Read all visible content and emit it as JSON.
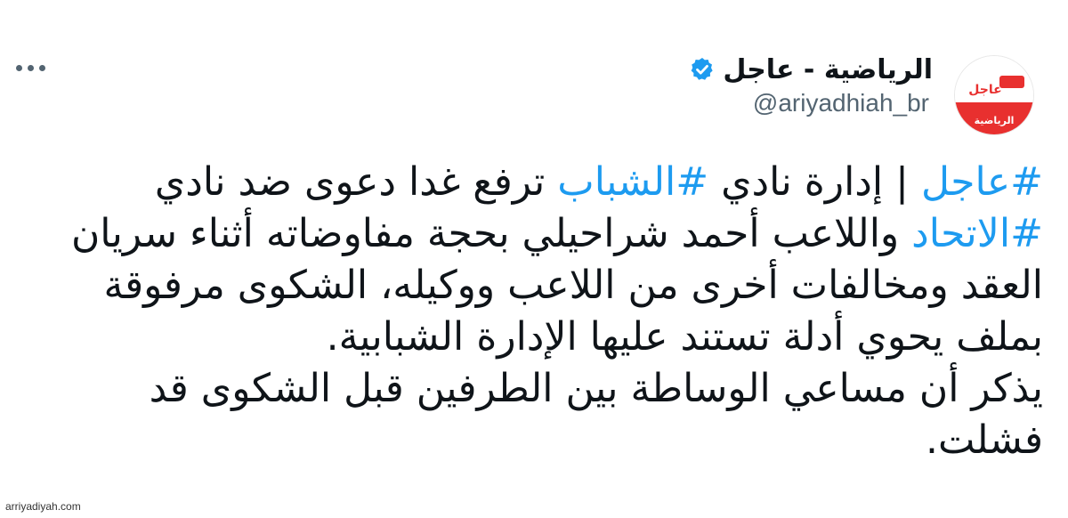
{
  "tweet": {
    "avatar": {
      "logo_word": "عاجل",
      "logo_sub": "الرياضية",
      "brand_color": "#e8302f"
    },
    "display_name": "الرياضية - عاجل",
    "verified": true,
    "verified_color": "#1d9bf0",
    "handle": "@ariyadhiah_br",
    "more_icon": "more-horizontal-icon",
    "hashtag_color": "#1d9bf0",
    "body": {
      "hashtag_1": "#عاجل",
      "seg_1": " | إدارة نادي ",
      "hashtag_2": "#الشباب",
      "seg_2": " ترفع غدا دعوى ضد نادي ",
      "hashtag_3": "#الاتحاد",
      "seg_3": " واللاعب أحمد شراحيلي بحجة مفاوضاته أثناء سريان العقد ومخالفات أخرى من اللاعب ووكيله، الشكوى مرفوقة بملف يحوي أدلة تستند عليها الإدارة الشبابية.",
      "seg_4": "يذكر أن مساعي الوساطة بين الطرفين قبل الشكوى قد فشلت."
    }
  },
  "watermark": "arriyadiyah.com"
}
